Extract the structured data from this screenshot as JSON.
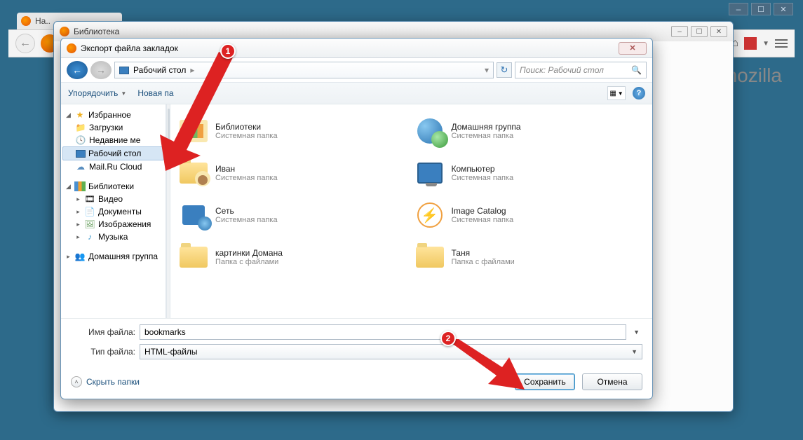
{
  "firefox": {
    "tab_title": "На..",
    "brand": "mozilla"
  },
  "library": {
    "title": "Библиотека"
  },
  "dialog": {
    "title": "Экспорт файла закладок",
    "breadcrumb": "Рабочий стол",
    "search_placeholder": "Поиск: Рабочий стол",
    "organize": "Упорядочить",
    "new_folder": "Новая па",
    "filename_label": "Имя файла:",
    "filename_value": "bookmarks",
    "filetype_label": "Тип файла:",
    "filetype_value": "HTML-файлы",
    "hide_folders": "Скрыть папки",
    "save": "Сохранить",
    "cancel": "Отмена"
  },
  "tree": {
    "favorites": "Избранное",
    "downloads": "Загрузки",
    "recent": "Недавние ме",
    "desktop": "Рабочий стол",
    "mailru": "Mail.Ru Cloud",
    "libraries": "Библиотеки",
    "video": "Видео",
    "documents": "Документы",
    "pictures": "Изображения",
    "music": "Музыка",
    "homegroup": "Домашняя группа"
  },
  "items": [
    {
      "name": "Библиотеки",
      "sub": "Системная папка",
      "icon": "lib"
    },
    {
      "name": "Домашняя группа",
      "sub": "Системная папка",
      "icon": "homegroup"
    },
    {
      "name": "Иван",
      "sub": "Системная папка",
      "icon": "person"
    },
    {
      "name": "Компьютер",
      "sub": "Системная папка",
      "icon": "comp"
    },
    {
      "name": "Сеть",
      "sub": "Системная папка",
      "icon": "net"
    },
    {
      "name": "Image Catalog",
      "sub": "Системная папка",
      "icon": "bolt"
    },
    {
      "name": "картинки Домана",
      "sub": "Папка с файлами",
      "icon": "folder"
    },
    {
      "name": "Таня",
      "sub": "Папка с файлами",
      "icon": "folder"
    }
  ],
  "annotations": {
    "b1": "1",
    "b2": "2"
  }
}
